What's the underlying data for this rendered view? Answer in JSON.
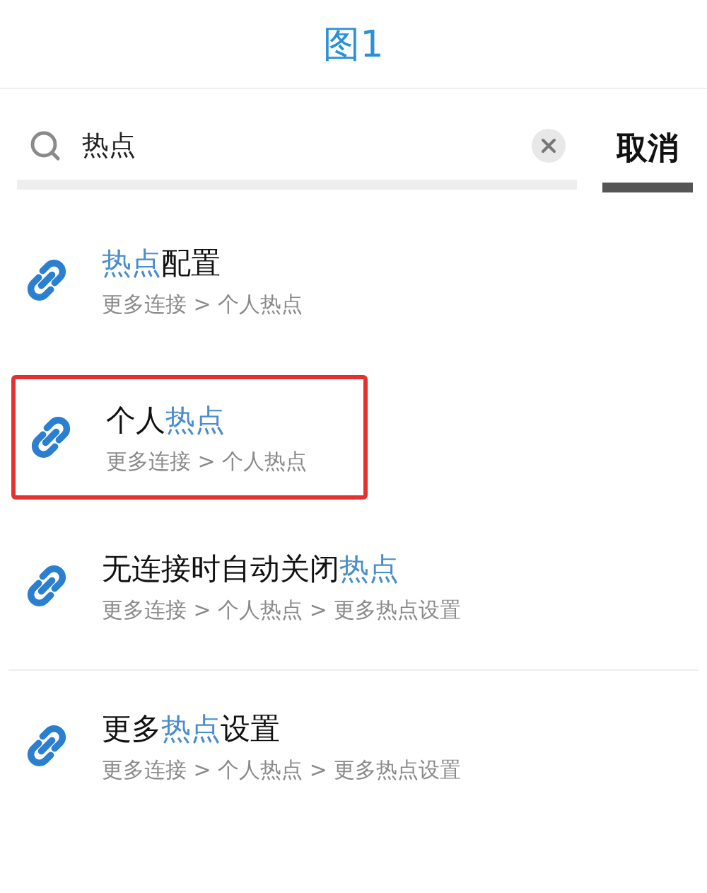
{
  "figure_title": "图1",
  "search": {
    "value": "热点",
    "cancel": "取消"
  },
  "results": [
    {
      "title": [
        {
          "text": "热点",
          "match": true
        },
        {
          "text": "配置",
          "match": false
        }
      ],
      "path": "更多连接 > 个人热点",
      "framed": false,
      "divider_below": false
    },
    {
      "title": [
        {
          "text": "个人",
          "match": false
        },
        {
          "text": "热点",
          "match": true
        }
      ],
      "path": "更多连接 > 个人热点",
      "framed": true,
      "divider_below": false
    },
    {
      "title": [
        {
          "text": "无连接时自动关闭",
          "match": false
        },
        {
          "text": "热点",
          "match": true
        }
      ],
      "path": "更多连接 > 个人热点 > 更多热点设置",
      "framed": false,
      "divider_below": true
    },
    {
      "title": [
        {
          "text": "更多",
          "match": false
        },
        {
          "text": "热点",
          "match": true
        },
        {
          "text": "设置",
          "match": false
        }
      ],
      "path": "更多连接 > 个人热点 > 更多热点设置",
      "framed": false,
      "divider_below": false
    }
  ]
}
